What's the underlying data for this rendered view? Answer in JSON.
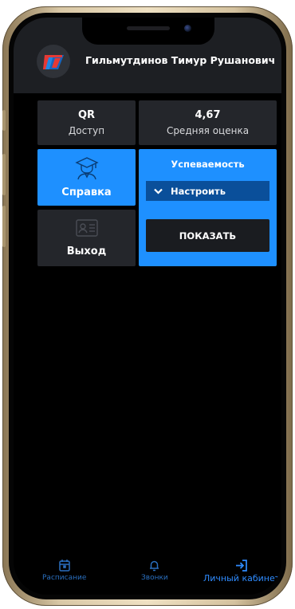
{
  "header": {
    "user_name": "Гильмутдинов Тимур Рушанович"
  },
  "tiles": {
    "qr": {
      "title": "QR",
      "subtitle": "Доступ"
    },
    "grade": {
      "value": "4,67",
      "subtitle": "Средняя оценка"
    },
    "reference": {
      "label": "Справка",
      "icon": "graduate-icon"
    },
    "exit": {
      "label": "Выход",
      "icon": "id-card-icon"
    }
  },
  "performance": {
    "title": "Успеваемость",
    "select_label": "Настроить",
    "show_button": "ПОКАЗАТЬ"
  },
  "tabbar": {
    "items": [
      {
        "label": "Расписание",
        "icon": "calendar-icon",
        "active": false
      },
      {
        "label": "Звонки",
        "icon": "bell-icon",
        "active": false
      },
      {
        "label": "Личный кабинет",
        "icon": "login-icon",
        "active": true
      }
    ]
  },
  "colors": {
    "accent": "#1e90ff",
    "tile_dark": "#24262b",
    "header_bg": "#1d1f23",
    "select_bg": "#0a4f9a",
    "background": "#000000"
  }
}
